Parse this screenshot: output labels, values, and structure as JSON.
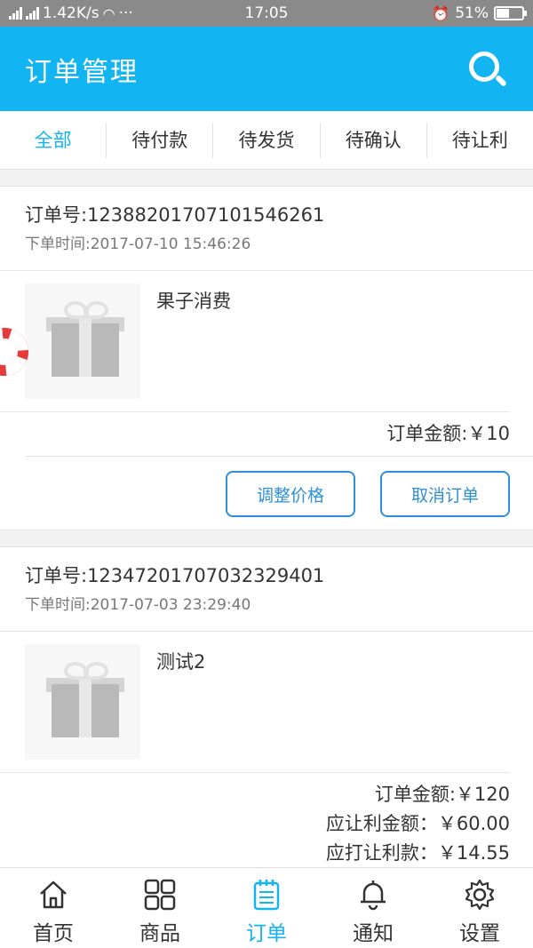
{
  "status_bar": {
    "network": "2G 4G",
    "speed": "1.42K/s",
    "dots": "···",
    "time": "17:05",
    "battery": "51%"
  },
  "header": {
    "title": "订单管理",
    "search_icon": "search-icon"
  },
  "tabs": [
    {
      "label": "全部",
      "active": true
    },
    {
      "label": "待付款",
      "active": false
    },
    {
      "label": "待发货",
      "active": false
    },
    {
      "label": "待确认",
      "active": false
    },
    {
      "label": "待让利",
      "active": false
    }
  ],
  "orders": [
    {
      "order_no": "订单号:12388201707101546261",
      "order_time": "下单时间:2017-07-10 15:46:26",
      "item_name": "果子消费",
      "amount": "订单金额:￥10",
      "actions": [
        "调整价格",
        "取消订单"
      ]
    },
    {
      "order_no": "订单号:12347201707032329401",
      "order_time": "下单时间:2017-07-03 23:29:40",
      "item_name": "测试2",
      "amount": "订单金额:￥120",
      "discount_amount": "应让利金额：￥60.00",
      "discount_payment": "应打让利款：￥14.55"
    }
  ],
  "bottom_nav": [
    {
      "label": "首页",
      "icon": "home-icon",
      "active": false
    },
    {
      "label": "商品",
      "icon": "grid-icon",
      "active": false
    },
    {
      "label": "订单",
      "icon": "calendar-icon",
      "active": true
    },
    {
      "label": "通知",
      "icon": "bell-icon",
      "active": false
    },
    {
      "label": "设置",
      "icon": "gear-icon",
      "active": false
    }
  ],
  "colors": {
    "accent": "#12b4f2",
    "button": "#2e8fd6",
    "status_bar": "#8a8a8a"
  }
}
